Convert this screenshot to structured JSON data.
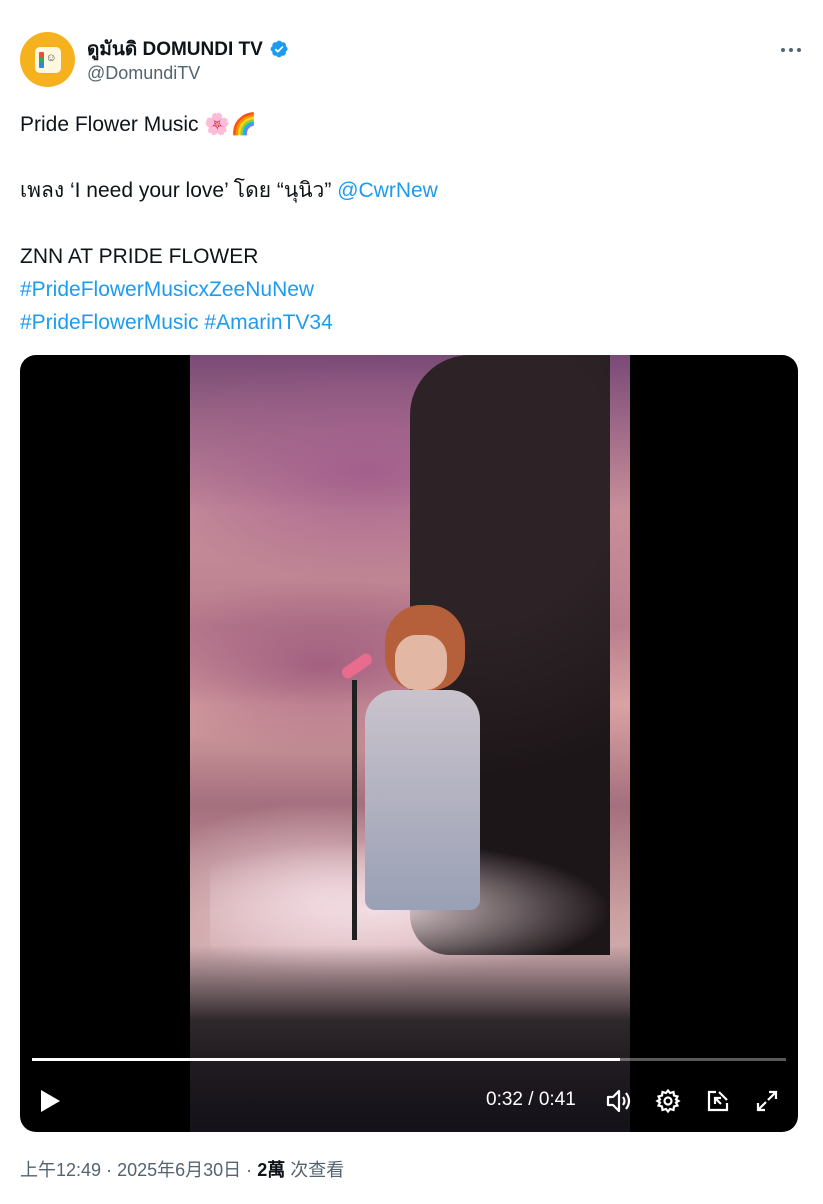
{
  "author": {
    "display_name": "ดูมันดิ DOMUNDI TV",
    "handle": "@DomundiTV",
    "verified": true,
    "avatar_color": "#f5b21e"
  },
  "tweet": {
    "lines": [
      {
        "text": "Pride Flower Music 🌸🌈"
      },
      {
        "text": "เพลง ‘I need your love’ โดย “นุนิว”",
        "mention": "@CwrNew"
      },
      {
        "text": "ZNN AT PRIDE FLOWER"
      }
    ],
    "hashtags": [
      "#PrideFlowerMusicxZeeNuNew",
      "#PrideFlowerMusic",
      "#AmarinTV34"
    ]
  },
  "video": {
    "current_time": "0:32",
    "duration": "0:41",
    "time_display": "0:32 / 0:41",
    "progress": 0.78
  },
  "meta": {
    "time": "上午12:49",
    "date": "2025年6月30日",
    "separator": "·",
    "views_count": "2萬",
    "views_label": "次查看"
  },
  "colors": {
    "link": "#1d9bf0",
    "muted": "#536471",
    "text": "#0f1419"
  }
}
